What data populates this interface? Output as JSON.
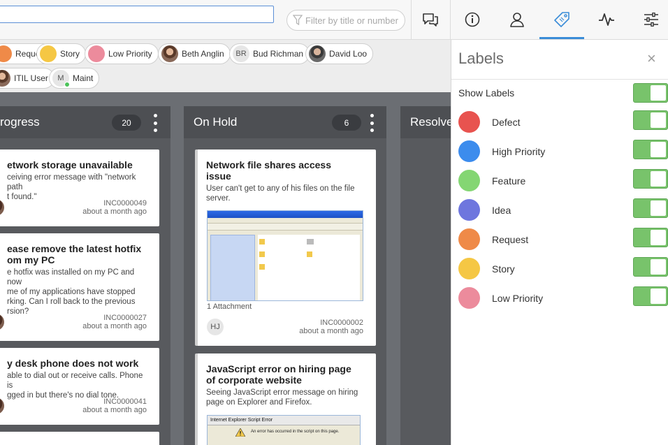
{
  "topbar": {
    "filter_placeholder": "Filter by title or number"
  },
  "chips": [
    {
      "label": "Request",
      "color": "#ef8a48",
      "kind": "label"
    },
    {
      "label": "Story",
      "color": "#f5c744",
      "kind": "label"
    },
    {
      "label": "Low Priority",
      "color": "#ec8b9c",
      "kind": "label"
    },
    {
      "label": "Beth Anglin",
      "kind": "photo"
    },
    {
      "label": "Bud Richman",
      "initials": "BR",
      "kind": "initials"
    },
    {
      "label": "David Loo",
      "kind": "photo"
    },
    {
      "label": "ITIL User",
      "kind": "photo"
    },
    {
      "label": "Maint",
      "initials": "M",
      "kind": "initials-online"
    }
  ],
  "columns": [
    {
      "title": "rogress",
      "count": "20"
    },
    {
      "title": "On Hold",
      "count": "6"
    },
    {
      "title": "Resolve"
    }
  ],
  "cards": {
    "c1": {
      "title": "etwork storage unavailable",
      "desc_1": "ceiving error message with \"network path",
      "desc_2": "t found.\"",
      "number": "INC0000049",
      "time": "about a month ago"
    },
    "c2": {
      "title_1": "ease remove the latest hotfix",
      "title_2": "om my PC",
      "desc_1": "e hotfix was installed on my PC and now",
      "desc_2": "me of my applications have stopped",
      "desc_3": "rking. Can I roll back to the previous",
      "desc_4": "rsion?",
      "number": "INC0000027",
      "time": "about a month ago"
    },
    "c3": {
      "title": "y desk phone does not work",
      "desc_1": "able to dial out or receive calls. Phone is",
      "desc_2": "gged in but there's no dial tone.",
      "number": "INC0000041",
      "time": "about a month ago"
    },
    "h1": {
      "title_1": "Network file shares access",
      "title_2": "issue",
      "desc_1": "User can't get to any of his files on the file",
      "desc_2": "server.",
      "attachments": "1 Attachment",
      "initials": "HJ",
      "number": "INC0000002",
      "time": "about a month ago"
    },
    "h2": {
      "title_1": "JavaScript error on hiring page",
      "title_2": "of corporate website",
      "desc_1": "Seeing JavaScript error message on hiring",
      "desc_2": "page on Explorer and Firefox.",
      "thumb_title": "Internet Explorer Script Error",
      "thumb_msg": "An error has occurred in the script on this page."
    }
  },
  "panel": {
    "title": "Labels",
    "close": "×",
    "show_labels": "Show Labels",
    "labels": [
      {
        "name": "Defect",
        "color": "#e8534f"
      },
      {
        "name": "High Priority",
        "color": "#3c8ced"
      },
      {
        "name": "Feature",
        "color": "#84d673"
      },
      {
        "name": "Idea",
        "color": "#6e76de"
      },
      {
        "name": "Request",
        "color": "#ef8a48"
      },
      {
        "name": "Story",
        "color": "#f5c744"
      },
      {
        "name": "Low Priority",
        "color": "#ec8b9c"
      }
    ]
  }
}
